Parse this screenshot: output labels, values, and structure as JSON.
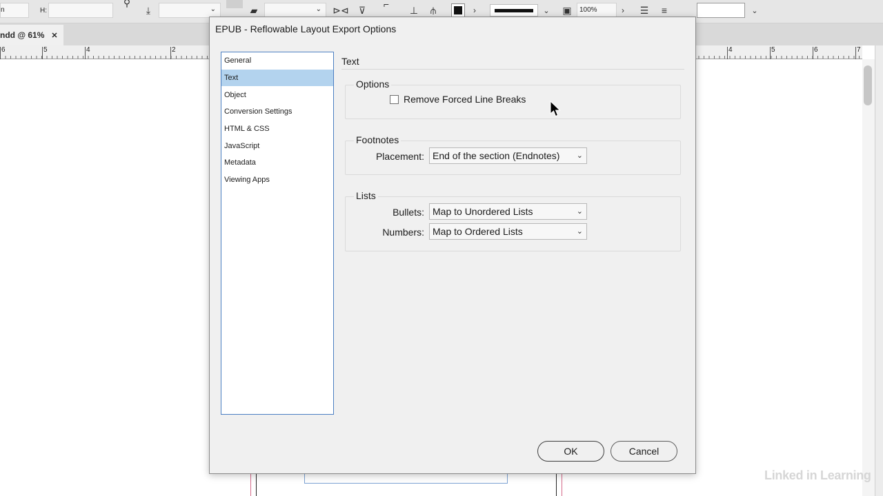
{
  "app": {
    "toolbar": {
      "field_w_prefix": "n",
      "height_label": "H:",
      "zoom_value": "100%"
    },
    "document_tab": {
      "label": "ndd @ 61%",
      "close_glyph": "✕"
    },
    "ruler_numbers": [
      "6",
      "5",
      "4",
      "2",
      "4",
      "5",
      "6",
      "7"
    ],
    "watermark": "Linked in Learning"
  },
  "dialog": {
    "title": "EPUB - Reflowable Layout Export Options",
    "categories": [
      {
        "label": "General"
      },
      {
        "label": "Text"
      },
      {
        "label": "Object"
      },
      {
        "label": "Conversion Settings"
      },
      {
        "label": "HTML & CSS"
      },
      {
        "label": "JavaScript"
      },
      {
        "label": "Metadata"
      },
      {
        "label": "Viewing Apps"
      }
    ],
    "selected_category": "Text",
    "section_heading": "Text",
    "options_group": {
      "title": "Options",
      "remove_line_breaks_label": "Remove Forced Line Breaks",
      "remove_line_breaks_checked": false
    },
    "footnotes_group": {
      "title": "Footnotes",
      "placement_label": "Placement:",
      "placement_value": "End of the section (Endnotes)"
    },
    "lists_group": {
      "title": "Lists",
      "bullets_label": "Bullets:",
      "bullets_value": "Map to Unordered Lists",
      "numbers_label": "Numbers:",
      "numbers_value": "Map to Ordered Lists"
    },
    "buttons": {
      "ok": "OK",
      "cancel": "Cancel"
    }
  },
  "colors": {
    "selection_highlight": "#b3d3ee",
    "list_border": "#4a7ec2",
    "dialog_bg": "#f0f0f0"
  }
}
